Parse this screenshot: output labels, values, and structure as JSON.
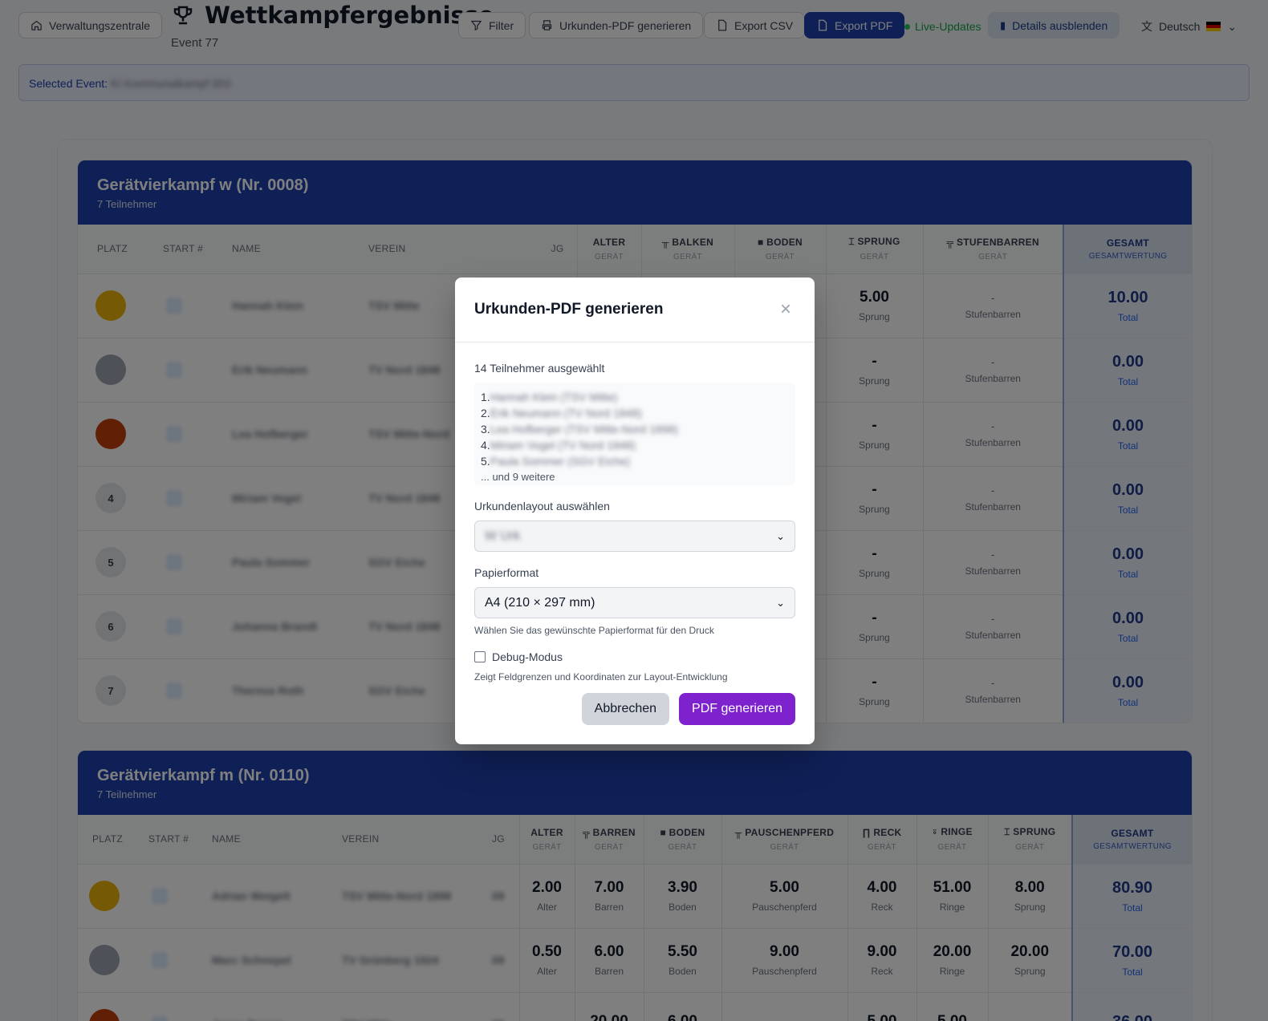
{
  "header": {
    "admin_label": "Verwaltungszentrale",
    "title": "Wettkampfergebnisse",
    "subtitle": "Event 77",
    "filter_label": "Filter",
    "cert_label": "Urkunden-PDF generieren",
    "csv_label": "Export CSV",
    "pdf_label": "Export PDF",
    "live_label": "Live-Updates",
    "details_label": "Details ausblenden",
    "language": "Deutsch"
  },
  "selected_event": {
    "label": "Selected Event:",
    "value": "KI Kommunalkampf 003"
  },
  "groups": [
    {
      "title": "Gerätvierkampf w (Nr. 0008)",
      "participants": "7 Teilnehmer",
      "columns": {
        "place": "PLATZ",
        "start": "START #",
        "name": "NAME",
        "club": "VEREIN",
        "year": "JG"
      },
      "disciplines": [
        {
          "label": "ALTER",
          "sub": "GERÄT"
        },
        {
          "label": "BALKEN",
          "sub": "GERÄT"
        },
        {
          "label": "BODEN",
          "sub": "GERÄT"
        },
        {
          "label": "SPRUNG",
          "sub": "GERÄT"
        },
        {
          "label": "STUFENBARREN",
          "sub": "GERÄT"
        }
      ],
      "total": {
        "label": "GESAMT",
        "sub": "GESAMTWERTUNG"
      },
      "rows": [
        {
          "place": "",
          "sprung": "5.00",
          "sprung_l": "Sprung",
          "stufen": "-",
          "stufen_l": "Stufenbarren",
          "total": "10.00",
          "total_l": "Total"
        },
        {
          "place": "",
          "sprung": "-",
          "sprung_l": "Sprung",
          "stufen": "-",
          "stufen_l": "Stufenbarren",
          "total": "0.00",
          "total_l": "Total"
        },
        {
          "place": "",
          "sprung": "-",
          "sprung_l": "Sprung",
          "stufen": "-",
          "stufen_l": "Stufenbarren",
          "total": "0.00",
          "total_l": "Total"
        },
        {
          "place": "4",
          "sprung": "-",
          "sprung_l": "Sprung",
          "stufen": "-",
          "stufen_l": "Stufenbarren",
          "total": "0.00",
          "total_l": "Total"
        },
        {
          "place": "5",
          "sprung": "-",
          "sprung_l": "Sprung",
          "stufen": "-",
          "stufen_l": "Stufenbarren",
          "total": "0.00",
          "total_l": "Total"
        },
        {
          "place": "6",
          "sprung": "-",
          "sprung_l": "Sprung",
          "stufen": "-",
          "stufen_l": "Stufenbarren",
          "total": "0.00",
          "total_l": "Total"
        },
        {
          "place": "7",
          "sprung": "-",
          "sprung_l": "Sprung",
          "stufen": "-",
          "stufen_l": "Stufenbarren",
          "total": "0.00",
          "total_l": "Total"
        }
      ]
    },
    {
      "title": "Gerätvierkampf m (Nr. 0110)",
      "participants": "7 Teilnehmer",
      "columns": {
        "place": "PLATZ",
        "start": "START #",
        "name": "NAME",
        "club": "VEREIN",
        "year": "JG"
      },
      "disciplines": [
        {
          "label": "ALTER",
          "sub": "GERÄT"
        },
        {
          "label": "BARREN",
          "sub": "GERÄT"
        },
        {
          "label": "BODEN",
          "sub": "GERÄT"
        },
        {
          "label": "PAUSCHENPFERD",
          "sub": "GERÄT"
        },
        {
          "label": "RECK",
          "sub": "GERÄT"
        },
        {
          "label": "RINGE",
          "sub": "GERÄT"
        },
        {
          "label": "SPRUNG",
          "sub": "GERÄT"
        }
      ],
      "total": {
        "label": "GESAMT",
        "sub": "GESAMTWERTUNG"
      },
      "rows": [
        {
          "scores": [
            "2.00",
            "7.00",
            "3.90",
            "5.00",
            "4.00",
            "51.00",
            "8.00"
          ],
          "labels": [
            "Alter",
            "Barren",
            "Boden",
            "Pauschenpferd",
            "Reck",
            "Ringe",
            "Sprung"
          ],
          "total": "80.90",
          "total_l": "Total"
        },
        {
          "scores": [
            "0.50",
            "6.00",
            "5.50",
            "9.00",
            "9.00",
            "20.00",
            "20.00"
          ],
          "labels": [
            "Alter",
            "Barren",
            "Boden",
            "Pauschenpferd",
            "Reck",
            "Ringe",
            "Sprung"
          ],
          "total": "70.00",
          "total_l": "Total"
        },
        {
          "scores": [
            "",
            "20.00",
            "6.00",
            "",
            "5.00",
            "5.00",
            ""
          ],
          "labels": [
            "",
            "",
            "",
            "",
            "",
            "",
            ""
          ],
          "total": "36.00",
          "total_l": ""
        }
      ]
    }
  ],
  "modal": {
    "title": "Urkunden-PDF generieren",
    "selected_count": "14 Teilnehmer ausgewählt",
    "list": [
      "1.",
      "2.",
      "3.",
      "4.",
      "5."
    ],
    "more": "... und 9 weitere",
    "layout_label": "Urkundenlayout auswählen",
    "layout_value": "W Urk",
    "paper_label": "Papierformat",
    "paper_value": "A4 (210 × 297 mm)",
    "paper_hint": "Wählen Sie das gewünschte Papierformat für den Druck",
    "debug_label": "Debug-Modus",
    "debug_hint": "Zeigt Feldgrenzen und Koordinaten zur Layout-Entwicklung",
    "cancel": "Abbrechen",
    "submit": "PDF generieren"
  },
  "colors": {
    "primary": "#1e40af",
    "submit": "#7e22ce",
    "live": "#16a34a"
  }
}
